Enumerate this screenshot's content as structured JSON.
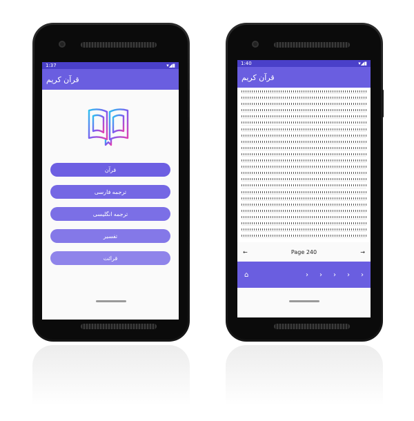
{
  "left_phone": {
    "status": {
      "time": "1:37"
    },
    "app_title": "قرآن کریم",
    "menu": [
      {
        "label": "قرآن",
        "color": "#6d5fe2"
      },
      {
        "label": "ترجمه فارسی",
        "color": "#7467e4"
      },
      {
        "label": "ترجمه انگلیسی",
        "color": "#7b6fe6"
      },
      {
        "label": "تفسیر",
        "color": "#8478e8"
      },
      {
        "label": "قرائت",
        "color": "#8f84ea"
      }
    ]
  },
  "right_phone": {
    "status": {
      "time": "1:40"
    },
    "app_title": "قرآن کریم",
    "pager": {
      "prev": "←",
      "label": "Page 240",
      "next": "→"
    },
    "bottom_nav": {
      "home": "⌂",
      "arrows": [
        "›",
        "›",
        "›",
        "›",
        "›"
      ]
    }
  },
  "colors": {
    "primary": "#6a5ee0",
    "status_bar": "#4a40c9"
  }
}
